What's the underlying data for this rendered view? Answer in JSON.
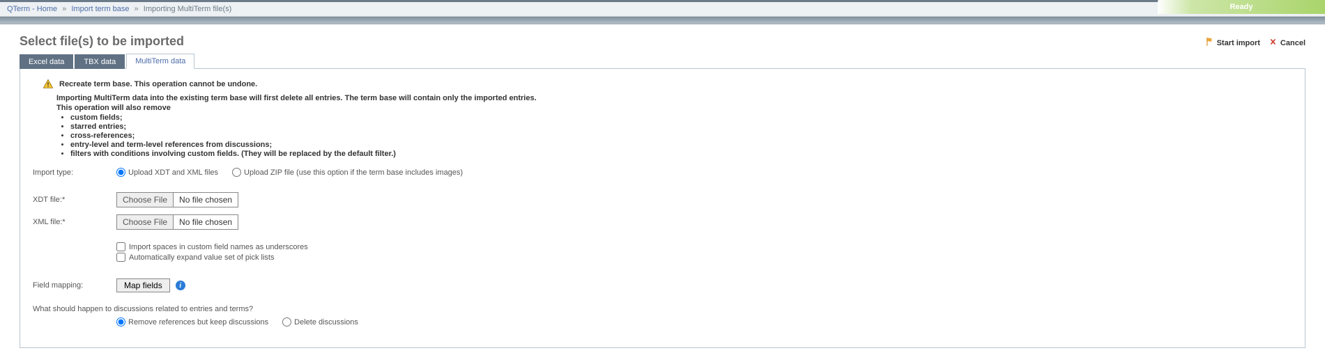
{
  "breadcrumb": {
    "home": "QTerm - Home",
    "import_base": "Import term base",
    "current": "Importing MultiTerm file(s)"
  },
  "status_label": "Ready",
  "page_title": "Select file(s) to be imported",
  "actions": {
    "start_import": "Start import",
    "cancel": "Cancel"
  },
  "tabs": {
    "excel": "Excel data",
    "tbx": "TBX data",
    "multiterm": "MultiTerm data"
  },
  "warning_title": "Recreate term base. This operation cannot be undone.",
  "desc_line1": "Importing MultiTerm data into the existing term base will first delete all entries. The term base will contain only the imported entries.",
  "desc_line2": "This operation will also remove",
  "desc_items": [
    "custom fields;",
    "starred entries;",
    "cross-references;",
    "entry-level and term-level references from discussions;",
    "filters with conditions involving custom fields. (They will be replaced by the default filter.)"
  ],
  "form": {
    "import_type_label": "Import type:",
    "opt_xdt_xml": "Upload XDT and XML files",
    "opt_zip": "Upload ZIP file (use this option if the term base includes images)",
    "xdt_label": "XDT file:*",
    "xml_label": "XML file:*",
    "choose_file": "Choose File",
    "no_file": "No file chosen",
    "chk_spaces": "Import spaces in custom field names as underscores",
    "chk_expand": "Automatically expand value set of pick lists",
    "field_mapping_label": "Field mapping:",
    "map_fields_btn": "Map fields",
    "discussion_question": "What should happen to discussions related to entries and terms?",
    "opt_remove_refs": "Remove references but keep discussions",
    "opt_delete_disc": "Delete discussions"
  }
}
